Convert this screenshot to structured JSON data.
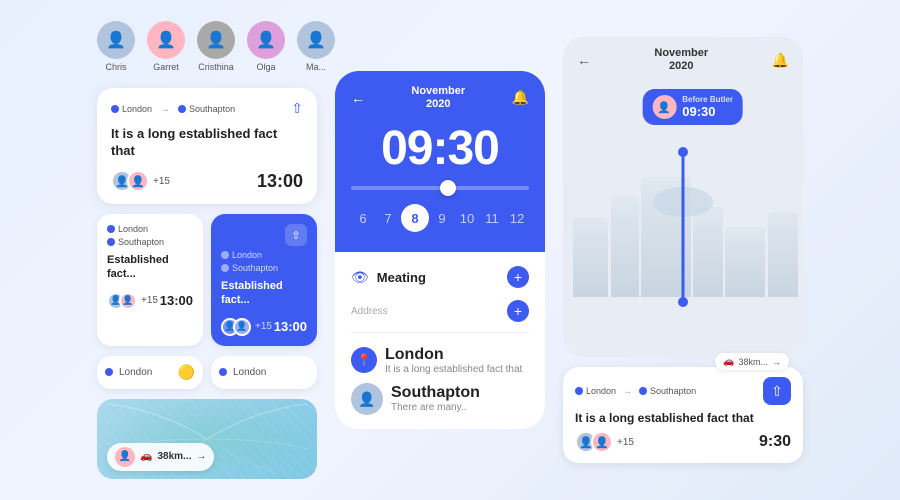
{
  "avatars": [
    {
      "name": "Chris",
      "emoji": "👤",
      "type": "male"
    },
    {
      "name": "Garret",
      "emoji": "👤",
      "type": "female"
    },
    {
      "name": "Cristhina",
      "emoji": "👤",
      "type": "male2"
    },
    {
      "name": "Olga",
      "emoji": "👤",
      "type": "female2"
    },
    {
      "name": "Ma...",
      "emoji": "👤",
      "type": "male"
    }
  ],
  "card1": {
    "loc_from": "London",
    "loc_to": "Southapton",
    "title": "It is a long established fact that",
    "time": "13:00",
    "plus_count": "+15"
  },
  "card2a": {
    "loc": "London",
    "loc2": "Southapton",
    "title": "Established fact...",
    "time": "13:00",
    "plus_count": "+15"
  },
  "card2b": {
    "loc": "London",
    "loc2": "Southapton",
    "title": "Established fact...",
    "time": "13:00",
    "plus_count": "+15"
  },
  "card3a": {
    "loc": "London",
    "icon": "🟡"
  },
  "card3b": {
    "loc": "London"
  },
  "leaf_card": {
    "km": "38km...",
    "arrow": "→"
  },
  "phone": {
    "month": "November",
    "year": "2020",
    "time": "09:30",
    "numbers": [
      "6",
      "7",
      "8",
      "9",
      "10",
      "11",
      "12"
    ],
    "active_num": "8",
    "meeting_label": "Meating",
    "address_label": "Address",
    "dest1_name": "London",
    "dest1_sub": "It is a long established fact that",
    "dest2_name": "Southapton",
    "dest2_sub": "There are many.."
  },
  "map": {
    "month": "November",
    "year": "2020",
    "time_bubble": "09:30",
    "bubble_label": "Before Butler",
    "car_km": "38km...",
    "bottom_card": {
      "loc_from": "London",
      "loc_to": "Southapton",
      "title": "It is a long established fact that",
      "time": "9:30",
      "plus_count": "+15"
    }
  },
  "icons": {
    "back": "←",
    "bell": "🔔",
    "eye": "👁",
    "plus": "+",
    "location": "📍",
    "car": "🚗",
    "share": "⇧"
  }
}
